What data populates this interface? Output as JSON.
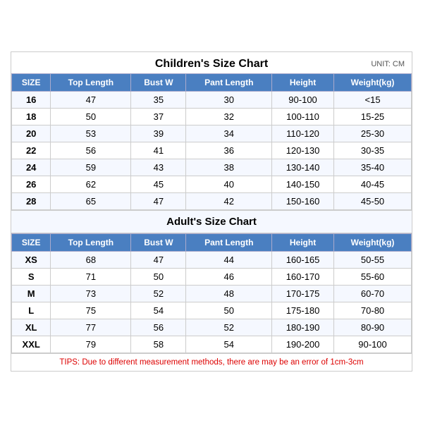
{
  "title": "Children's Size Chart",
  "unit": "UNIT: CM",
  "children_headers": [
    "SIZE",
    "Top Length",
    "Bust W",
    "Pant Length",
    "Height",
    "Weight(kg)"
  ],
  "children_rows": [
    [
      "16",
      "47",
      "35",
      "30",
      "90-100",
      "<15"
    ],
    [
      "18",
      "50",
      "37",
      "32",
      "100-110",
      "15-25"
    ],
    [
      "20",
      "53",
      "39",
      "34",
      "110-120",
      "25-30"
    ],
    [
      "22",
      "56",
      "41",
      "36",
      "120-130",
      "30-35"
    ],
    [
      "24",
      "59",
      "43",
      "38",
      "130-140",
      "35-40"
    ],
    [
      "26",
      "62",
      "45",
      "40",
      "140-150",
      "40-45"
    ],
    [
      "28",
      "65",
      "47",
      "42",
      "150-160",
      "45-50"
    ]
  ],
  "adults_title": "Adult's Size Chart",
  "adults_headers": [
    "SIZE",
    "Top Length",
    "Bust W",
    "Pant Length",
    "Height",
    "Weight(kg)"
  ],
  "adults_rows": [
    [
      "XS",
      "68",
      "47",
      "44",
      "160-165",
      "50-55"
    ],
    [
      "S",
      "71",
      "50",
      "46",
      "160-170",
      "55-60"
    ],
    [
      "M",
      "73",
      "52",
      "48",
      "170-175",
      "60-70"
    ],
    [
      "L",
      "75",
      "54",
      "50",
      "175-180",
      "70-80"
    ],
    [
      "XL",
      "77",
      "56",
      "52",
      "180-190",
      "80-90"
    ],
    [
      "XXL",
      "79",
      "58",
      "54",
      "190-200",
      "90-100"
    ]
  ],
  "tips": "TIPS: Due to different measurement methods, there are may be an error of 1cm-3cm"
}
